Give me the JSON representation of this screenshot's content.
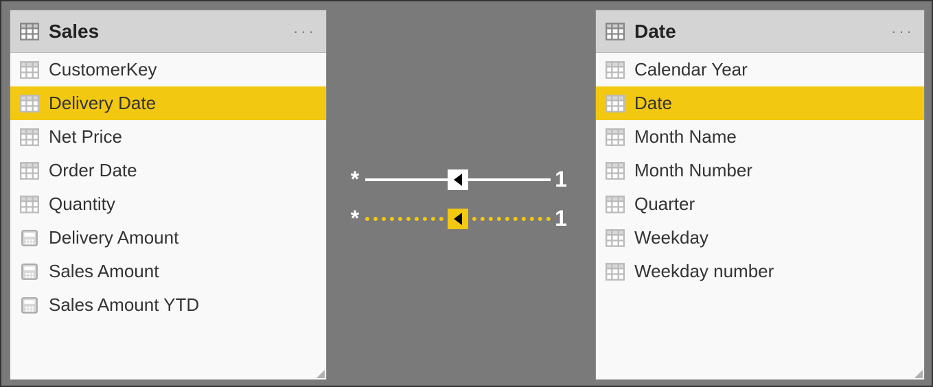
{
  "tables": {
    "sales": {
      "title": "Sales",
      "fields": [
        {
          "label": "CustomerKey",
          "type": "column",
          "selected": false
        },
        {
          "label": "Delivery Date",
          "type": "column",
          "selected": true
        },
        {
          "label": "Net Price",
          "type": "column",
          "selected": false
        },
        {
          "label": "Order Date",
          "type": "column",
          "selected": false
        },
        {
          "label": "Quantity",
          "type": "column",
          "selected": false
        },
        {
          "label": "Delivery Amount",
          "type": "measure",
          "selected": false
        },
        {
          "label": "Sales Amount",
          "type": "measure",
          "selected": false
        },
        {
          "label": "Sales Amount YTD",
          "type": "measure",
          "selected": false
        }
      ]
    },
    "date": {
      "title": "Date",
      "fields": [
        {
          "label": "Calendar Year",
          "type": "column",
          "selected": false
        },
        {
          "label": "Date",
          "type": "column",
          "selected": true
        },
        {
          "label": "Month Name",
          "type": "column",
          "selected": false
        },
        {
          "label": "Month Number",
          "type": "column",
          "selected": false
        },
        {
          "label": "Quarter",
          "type": "column",
          "selected": false
        },
        {
          "label": "Weekday",
          "type": "column",
          "selected": false
        },
        {
          "label": "Weekday number",
          "type": "column",
          "selected": false
        }
      ]
    }
  },
  "relationships": [
    {
      "from_cardinality": "*",
      "to_cardinality": "1",
      "style": "solid",
      "direction": "to-left",
      "color": "white"
    },
    {
      "from_cardinality": "*",
      "to_cardinality": "1",
      "style": "dashed",
      "direction": "to-left",
      "color": "yellow"
    }
  ]
}
